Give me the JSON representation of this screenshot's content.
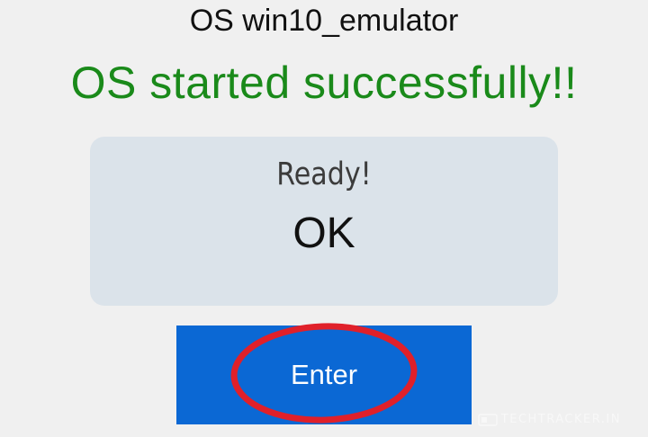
{
  "app": {
    "title": "OS win10_emulator"
  },
  "status": {
    "message": "OS started successfully!!",
    "color": "#1a8a1a"
  },
  "card": {
    "label": "Ready!",
    "value": "OK"
  },
  "actions": {
    "enter_label": "Enter",
    "button_color": "#0b68d4",
    "highlight_color": "#e0202a"
  },
  "watermark": {
    "text": "TECHTRACKER.IN",
    "icon": "techtracker-logo-icon"
  }
}
